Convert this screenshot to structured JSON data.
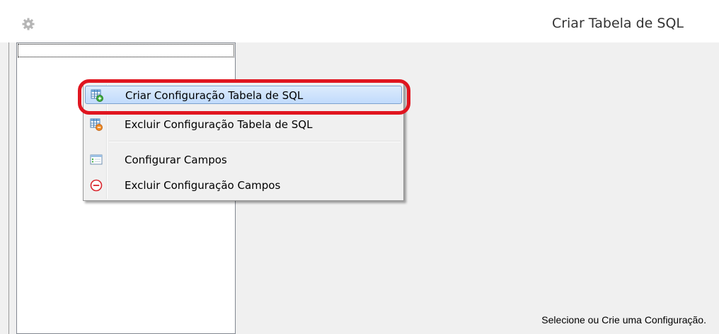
{
  "window": {
    "title": "Criar Tabela de SQL",
    "icon": "gear-icon"
  },
  "context_menu": {
    "items": [
      {
        "label": "Criar Configuração Tabela de SQL",
        "icon": "table-add-icon",
        "highlighted": true
      },
      {
        "label": "Excluir Configuração Tabela de SQL",
        "icon": "table-remove-icon",
        "highlighted": false
      },
      {
        "label": "Configurar Campos",
        "icon": "fields-icon",
        "highlighted": false
      },
      {
        "label": "Excluir Configuração Campos",
        "icon": "minus-circle-icon",
        "highlighted": false
      }
    ]
  },
  "status": {
    "message": "Selecione ou Crie uma Configuração."
  },
  "colors": {
    "annotation_red": "#e0151f",
    "menu_highlight": "#c1dbfc",
    "panel_background": "#f0f0f0"
  }
}
